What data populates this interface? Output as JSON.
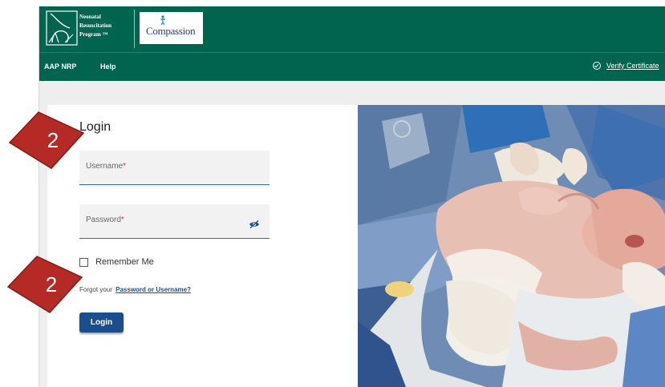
{
  "header": {
    "program_logo_lines": [
      "Neonatal",
      "Resuscitation",
      "Program ™"
    ],
    "partner_logo_text": "Compassion"
  },
  "nav": {
    "items": [
      "AAP NRP",
      "Help"
    ],
    "verify_label": "Verify Certificate"
  },
  "login": {
    "title": "Login",
    "username_label": "Username",
    "password_label": "Password",
    "required_marker": "*",
    "remember_label": "Remember Me",
    "remember_checked": false,
    "forgot_prefix": "Forgot your",
    "forgot_link": "Password or Username?",
    "button_label": "Login"
  },
  "callouts": [
    "2",
    "2"
  ],
  "colors": {
    "brand_green": "#00644f",
    "button_blue": "#1a4f8f",
    "callout_red": "#b52a25"
  },
  "icons": [
    "nrp-logo-icon",
    "eye-slash-icon",
    "check-circle-icon"
  ]
}
